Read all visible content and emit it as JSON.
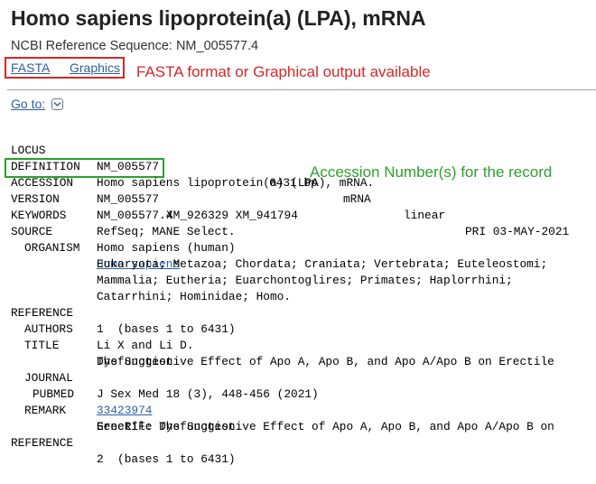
{
  "header": {
    "title": "Homo sapiens lipoprotein(a) (LPA), mRNA",
    "subtitle": "NCBI Reference Sequence: NM_005577.4",
    "links": {
      "fasta": "FASTA",
      "graphics": "Graphics"
    },
    "goto_label": "Go to:"
  },
  "annotations": {
    "links_note": "FASTA format or Graphical output available",
    "accession_note": "Accession Number(s) for the record",
    "links_box_color": "#d62728",
    "accession_box_color": "#2ca02c"
  },
  "record": {
    "locus": {
      "key": "LOCUS",
      "name": "NM_005577",
      "length": "6431 bp",
      "moltype": "mRNA",
      "topology": "linear",
      "division_date": "PRI 03-MAY-2021"
    },
    "definition": {
      "key": "DEFINITION",
      "value": "Homo sapiens lipoprotein(a) (LPA), mRNA."
    },
    "accession": {
      "key": "ACCESSION",
      "primary": "NM_005577",
      "secondary": "XM_926329 XM_941794"
    },
    "version": {
      "key": "VERSION",
      "value": "NM_005577.4"
    },
    "keywords": {
      "key": "KEYWORDS",
      "value": "RefSeq; MANE Select."
    },
    "source": {
      "key": "SOURCE",
      "value": "Homo sapiens (human)"
    },
    "organism": {
      "key": "ORGANISM",
      "name": "Homo sapiens",
      "lineage": [
        "Eukaryota; Metazoa; Chordata; Craniata; Vertebrata; Euteleostomi;",
        "Mammalia; Eutheria; Euarchontoglires; Primates; Haplorrhini;",
        "Catarrhini; Hominidae; Homo."
      ]
    },
    "reference1": {
      "key": "REFERENCE",
      "value": "1  (bases 1 to 6431)",
      "authors_key": "AUTHORS",
      "authors": "Li X and Li D.",
      "title_key": "TITLE",
      "title_lines": [
        "The Suggestive Effect of Apo A, Apo B, and Apo A/Apo B on Erectile",
        "Dysfunction"
      ],
      "journal_key": "JOURNAL",
      "journal": "J Sex Med 18 (3), 448-456 (2021)",
      "pubmed_key": "PUBMED",
      "pubmed": "33423974",
      "remark_key": "REMARK",
      "remark_lines": [
        "GeneRIF: The Suggestive Effect of Apo A, Apo B, and Apo A/Apo B on",
        "Erectile Dysfunction."
      ]
    },
    "reference2": {
      "key": "REFERENCE",
      "value": "2  (bases 1 to 6431)"
    }
  }
}
